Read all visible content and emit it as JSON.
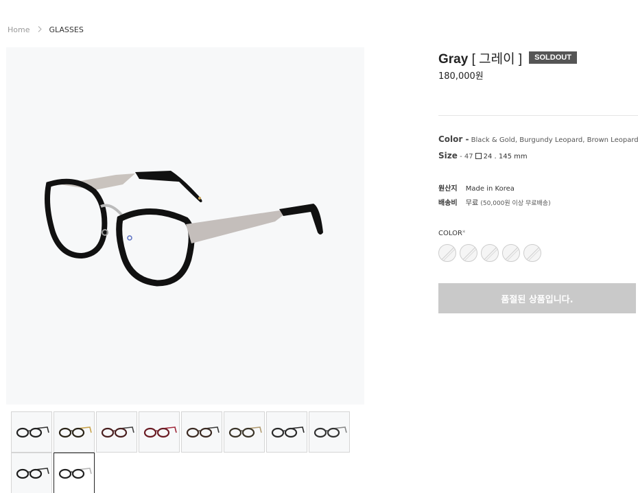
{
  "breadcrumb": {
    "home": "Home",
    "separator": ">",
    "current": "GLASSES"
  },
  "product": {
    "name_en": "Gray",
    "name_ko": "[ 그레이 ]",
    "badge": "SOLDOUT",
    "price": "180,000원",
    "color_label": "Color -",
    "color_value": "Black & Gold, Burgundy Leopard, Brown Leopard",
    "size_label": "Size",
    "size_prefix": "- 47",
    "size_dims": "24 . 145 mm",
    "origin_label": "원산지",
    "origin_value": "Made in Korea",
    "shipping_label": "배송비",
    "shipping_value": "무료",
    "shipping_note": "(50,000원 이상 무료배송)",
    "option_label": "COLOR",
    "option_required": "*",
    "soldout_button": "품절된 상품입니다."
  },
  "swatch_count": 5,
  "thumbnails": [
    {
      "temple": "#333333",
      "frame": "#222222"
    },
    {
      "temple": "#c8a24a",
      "frame": "#2a2418"
    },
    {
      "temple": "#444444",
      "frame": "#4a2020"
    },
    {
      "temple": "#a0283a",
      "frame": "#6a1c24"
    },
    {
      "temple": "#3a3a3a",
      "frame": "#3b2a22"
    },
    {
      "temple": "#b09a70",
      "frame": "#3a3428"
    },
    {
      "temple": "#2a2a2a",
      "frame": "#2b2b2b"
    },
    {
      "temple": "#888888",
      "frame": "#333333"
    },
    {
      "temple": "#333333",
      "frame": "#1c1c1c"
    },
    {
      "temple": "#b5b5b5",
      "frame": "#222222"
    }
  ],
  "selected_thumbnail": 9,
  "colors": {
    "badge_bg": "#555555",
    "soldout_button_bg": "#c9c9c9",
    "image_bg": "#f7f8f9"
  }
}
